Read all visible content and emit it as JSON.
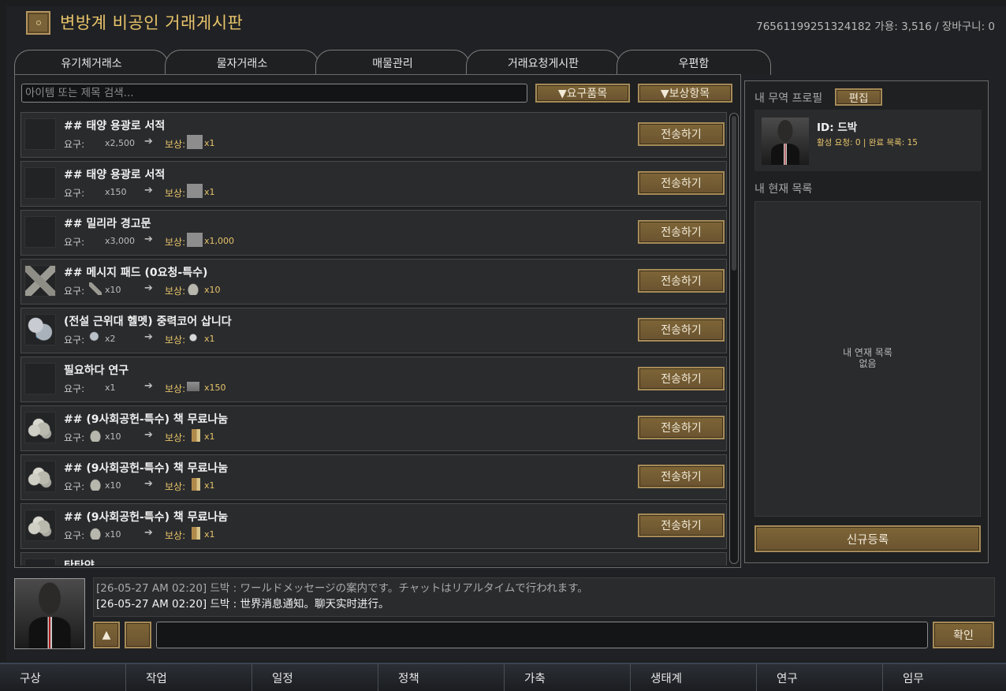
{
  "header": {
    "title": "변방계 비공인 거래게시판",
    "user_info": "76561199251324182   가용: 3,516 / 장바구니: 0"
  },
  "tabs": [
    {
      "label": "유기체거래소"
    },
    {
      "label": "물자거래소"
    },
    {
      "label": "매물관리"
    },
    {
      "label": "거래요청게시판"
    },
    {
      "label": "우편함"
    }
  ],
  "search": {
    "placeholder": "아이템 또는 제목 검색..."
  },
  "filters": {
    "required": "▼요구품목",
    "reward": "▼보상항목"
  },
  "listing": {
    "req_label": "요구:",
    "reward_label": "보상:",
    "arrow": "➔",
    "send_label": "전송하기",
    "rows": [
      {
        "title": "## 태양 용광로 서적",
        "req_qty": "x2,500",
        "reward_qty": "x1",
        "thumb": "empty",
        "req_icon": "none",
        "reward_icon": "gray-box"
      },
      {
        "title": " ## 태양 용광로 서적",
        "req_qty": "x150",
        "reward_qty": "x1",
        "thumb": "empty",
        "req_icon": "none",
        "reward_icon": "gray-box"
      },
      {
        "title": "## 밀리라 경고문",
        "req_qty": "x3,000",
        "reward_qty": "x1,000",
        "thumb": "empty",
        "req_icon": "none",
        "reward_icon": "gray-box"
      },
      {
        "title": "## 메시지 패드 (0요청-특수)",
        "req_qty": "x10",
        "reward_qty": "x10",
        "thumb": "pad",
        "req_icon": "pad",
        "reward_icon": "stone"
      },
      {
        "title": "(전설 근위대 헬멧) 중력코어 삽니다",
        "req_qty": "x2",
        "reward_qty": "x1",
        "thumb": "orb",
        "req_icon": "orb",
        "reward_icon": "cup"
      },
      {
        "title": "필요하다 연구",
        "req_qty": "x1",
        "reward_qty": "x150",
        "thumb": "empty",
        "req_icon": "none",
        "reward_icon": "tray"
      },
      {
        "title": "## (9사회공헌-특수) 책 무료나눔",
        "req_qty": "x10",
        "reward_qty": "x1",
        "thumb": "stones",
        "req_icon": "stone",
        "reward_icon": "book"
      },
      {
        "title": "## (9사회공헌-특수) 책 무료나눔",
        "req_qty": "x10",
        "reward_qty": "x1",
        "thumb": "stones",
        "req_icon": "stone",
        "reward_icon": "book"
      },
      {
        "title": "## (9사회공헌-특수) 책 무료나눔",
        "req_qty": "x10",
        "reward_qty": "x1",
        "thumb": "stones",
        "req_icon": "stone",
        "reward_icon": "book"
      },
      {
        "title": "탄탄약",
        "req_qty": "",
        "reward_qty": "",
        "thumb": "empty",
        "req_icon": "none",
        "reward_icon": "none"
      }
    ]
  },
  "profile": {
    "section_label": "내 무역 프로필",
    "edit_label": "편집",
    "id_text": "ID: 드박",
    "stats_text": "활성 요청: 0 | 완료 목록: 15",
    "current_list_label": "내 현재 목록",
    "empty_line1": "내 연재 목록",
    "empty_line2": "없음",
    "new_listing_label": "신규등록"
  },
  "chat": {
    "messages": [
      {
        "text": "[26-05-27 AM 02:20] 드박 : ワールドメッセージの案内です。チャットはリアルタイムで行われます。",
        "state": "old"
      },
      {
        "text": "[26-05-27 AM 02:20] 드박 : 世界消息通知。聊天实时进行。",
        "state": "new"
      }
    ],
    "up_label": "▲",
    "confirm_label": "확인"
  },
  "bottom_nav": [
    {
      "label": "구상"
    },
    {
      "label": "작업"
    },
    {
      "label": "일정"
    },
    {
      "label": "정책"
    },
    {
      "label": "가축"
    },
    {
      "label": "생태계"
    },
    {
      "label": "연구"
    },
    {
      "label": "임무"
    }
  ],
  "colors": {
    "accent_gold": "#e7c46a",
    "button_bronze": "#7e6537",
    "background": "#202124"
  }
}
